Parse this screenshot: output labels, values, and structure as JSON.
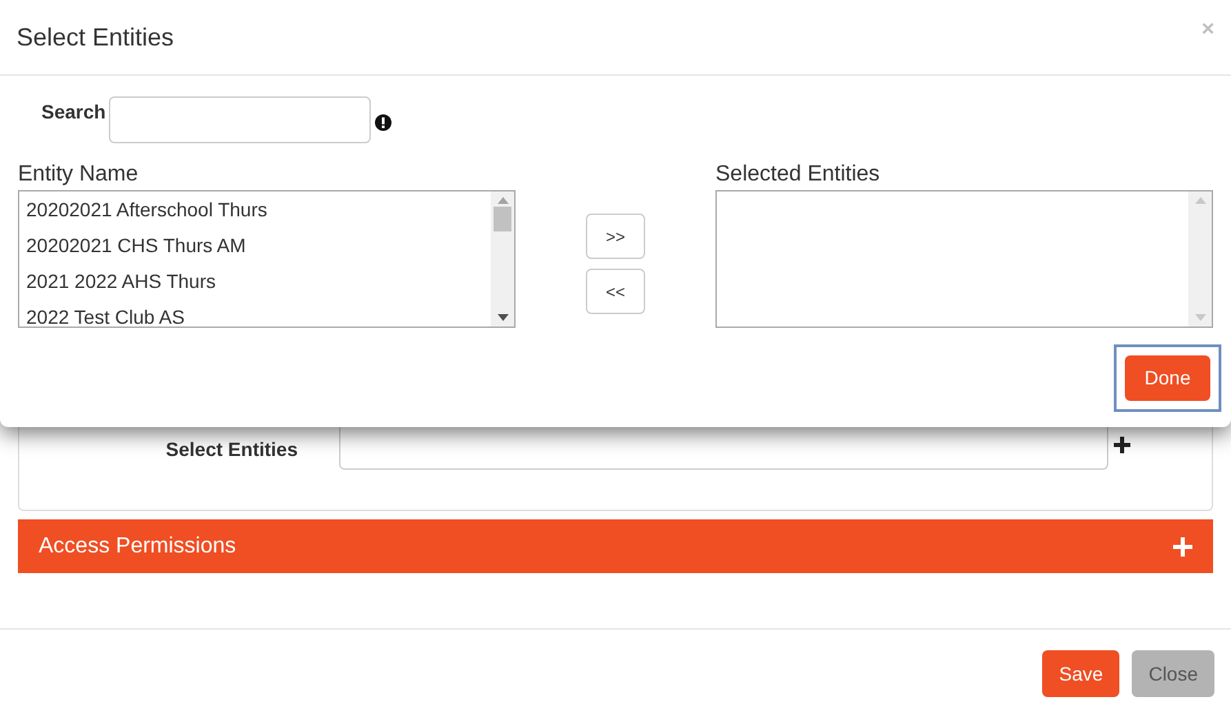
{
  "dialog": {
    "title": "Select Entities",
    "close": "×",
    "search": {
      "label": "Search"
    },
    "entity_list": {
      "label": "Entity Name",
      "items": [
        {
          "name": "20202021 Afterschool Thurs",
          "selected": false
        },
        {
          "name": "20202021 CHS Thurs AM",
          "selected": false
        },
        {
          "name": "2021 2022 AHS Thurs",
          "selected": false
        },
        {
          "name": "2022 Test Club AS",
          "selected": false
        }
      ]
    },
    "move_buttons": [
      ">>",
      "<<"
    ],
    "selected_list": {
      "label": "Selected Entities"
    },
    "done_button": {
      "label": "Done",
      "focused": true
    }
  },
  "form": {
    "select_entities": {
      "label": "Select Entities"
    },
    "section": {
      "title": "Access Permissions",
      "expanded": false
    },
    "buttons": [
      {
        "label": "Save",
        "kind": "primary"
      },
      {
        "label": "Close",
        "kind": "secondary"
      }
    ]
  }
}
